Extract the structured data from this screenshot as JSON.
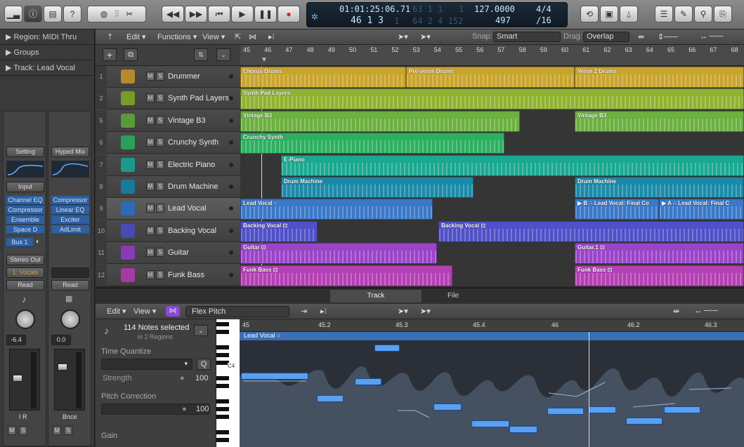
{
  "control_bar": {
    "lcd": {
      "time": "01:01:25:06.71",
      "bars": "46  1  3",
      "bars_sub": "1",
      "dim_top": "63  1  1",
      "dim_top2": "1",
      "dim_bottom": "64  2  4  152",
      "tempo": "127.0000",
      "beats": "497",
      "signature": "4/4",
      "division": "/16"
    }
  },
  "inspector": {
    "region_label": "▶ Region: MIDI Thru",
    "groups_label": "▶ Groups",
    "track_label": "▶ Track: Lead Vocal",
    "strip1": {
      "setting": "Setting",
      "input": "Input",
      "plugins": [
        "Channel EQ",
        "Compressor",
        "Ensemble",
        "Space D"
      ],
      "send": "Bus 1",
      "output": "Stereo Out",
      "group": "1: Vocals",
      "auto": "Read",
      "volume": "-6.4",
      "bottom": "I  R",
      "ms": [
        "M",
        "S"
      ]
    },
    "strip2": {
      "setting": "Hyped Mix",
      "plugins": [
        "Compressor",
        "Linear EQ",
        "Exciter",
        "AdLimit"
      ],
      "auto": "Read",
      "volume": "0.0",
      "bottom": "Bnce",
      "ms": [
        "M",
        "S"
      ]
    }
  },
  "tracks_toolbar": {
    "edit": "Edit ▾",
    "functions": "Functions ▾",
    "view": "View ▾",
    "snap_label": "Snap:",
    "snap_value": "Smart",
    "drag_label": "Drag:",
    "drag_value": "Overlap"
  },
  "ruler_bars": [
    "45",
    "46",
    "47",
    "48",
    "49",
    "50",
    "51",
    "52",
    "53",
    "54",
    "55",
    "56",
    "57",
    "58",
    "59",
    "60",
    "61",
    "62",
    "63",
    "64",
    "65",
    "66",
    "67",
    "68"
  ],
  "tracks": [
    {
      "num": "1",
      "name": "Drummer",
      "color": "#b58a2a"
    },
    {
      "num": "2",
      "name": "Synth Pad Layers",
      "color": "#7a9a2a"
    },
    {
      "num": "5",
      "name": "Vintage B3",
      "color": "#5a9a3a"
    },
    {
      "num": "6",
      "name": "Crunchy Synth",
      "color": "#2aa05a"
    },
    {
      "num": "7",
      "name": "Electric Piano",
      "color": "#1a9a8a"
    },
    {
      "num": "8",
      "name": "Drum Machine",
      "color": "#1a7a9a"
    },
    {
      "num": "9",
      "name": "Lead Vocal",
      "color": "#2e6ab5"
    },
    {
      "num": "10",
      "name": "Backing Vocal",
      "color": "#4a4ab5"
    },
    {
      "num": "11",
      "name": "Guitar",
      "color": "#8a3ab5"
    },
    {
      "num": "12",
      "name": "Funk Bass",
      "color": "#a53aa5"
    }
  ],
  "regions": {
    "chorus_drums": "Chorus Drums",
    "preverse_drums": "Pre-verse Drums",
    "verse2_drums": "Verse 2 Drums",
    "synth_pad": "Synth Pad Layers",
    "vintage1": "Vintage B3",
    "vintage2": "Vintage B3",
    "crunchy": "Crunchy Synth",
    "epiano": "E-Piano",
    "drum_machine1": "Drum Machine",
    "drum_machine2": "Drum Machine",
    "lead_vocal": "Lead Vocal  ○",
    "lead_vocal_b": "▶ B ∴ Lead Vocal: Final Co",
    "lead_vocal_a": "▶ A ∴ Lead Vocal: Final C",
    "backing1": "Backing Vocal  ⊡",
    "backing2": "Backing Vocal  ⊡",
    "guitar1": "Guitar  ⊡",
    "guitar2": "Guitar.1  ⊡",
    "funkbass1": "Funk Bass  ⊡",
    "funkbass2": "Funk Bass  ⊡"
  },
  "editor": {
    "tab_track": "Track",
    "tab_file": "File",
    "edit": "Edit ▾",
    "view": "View ▾",
    "mode": "Flex Pitch",
    "notes_selected": "114 Notes selected",
    "in_regions": "in 2 Regions",
    "time_quantize": "Time Quantize",
    "q_button": "Q",
    "strength_label": "Strength",
    "strength_value": "100",
    "pitch_correction": "Pitch Correction",
    "pitch_value": "100",
    "gain": "Gain",
    "c4": "C4",
    "ruler": [
      "45",
      "45.2",
      "45.3",
      "45.4",
      "46",
      "46.2",
      "46.3"
    ],
    "region_name": "Lead Vocal  ○"
  }
}
